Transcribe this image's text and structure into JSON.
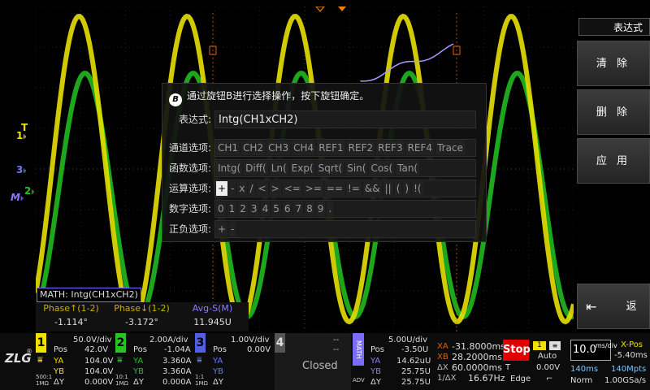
{
  "menu": {
    "title": "表达式",
    "buttons": [
      "清 除",
      "删 除",
      "应 用"
    ],
    "back": "返 回"
  },
  "channels_left": [
    {
      "label": "T",
      "color": "#f0e000"
    },
    {
      "label": "1",
      "color": "#f0e000"
    },
    {
      "label": "3",
      "color": "#6b78ff"
    },
    {
      "label": "M",
      "color": "#8a7cff"
    },
    {
      "label": "2",
      "color": "#24c424"
    }
  ],
  "dialog": {
    "hint": "通过旋钮B进行选择操作，按下旋钮确定。",
    "hint_icon": "B",
    "expr_label": "表达式:",
    "expr_value": "Intg(CH1xCH2)",
    "rows": [
      {
        "label": "通道选项:",
        "opts": [
          "CH1",
          "CH2",
          "CH3",
          "CH4",
          "REF1",
          "REF2",
          "REF3",
          "REF4",
          "Trace"
        ],
        "sel": -1
      },
      {
        "label": "函数选项:",
        "opts": [
          "Intg(",
          "Diff(",
          "Ln(",
          "Exp(",
          "Sqrt(",
          "Sin(",
          "Cos(",
          "Tan("
        ],
        "sel": -1
      },
      {
        "label": "运算选项:",
        "opts": [
          "+",
          "-",
          "x",
          "/",
          "<",
          ">",
          "<=",
          ">=",
          "==",
          "!=",
          "&&",
          "||",
          "(",
          ")",
          "!("
        ],
        "sel": 0
      },
      {
        "label": "数字选项:",
        "opts": [
          "0",
          "1",
          "2",
          "3",
          "4",
          "5",
          "6",
          "7",
          "8",
          "9",
          "."
        ],
        "sel": -1
      },
      {
        "label": "正负选项:",
        "opts": [
          "+",
          "-"
        ],
        "sel": -1
      }
    ]
  },
  "math_label": "MATH: Intg(CH1xCH2)",
  "measurements": [
    {
      "name": "Phase↑(1-2)",
      "value": "-1.114°"
    },
    {
      "name": "Phase↓(1-2)",
      "value": "-3.172°"
    },
    {
      "name": "Avg-S(M)",
      "value": "11.945U"
    }
  ],
  "ch1": {
    "num": "1",
    "div": "50.0V/div",
    "pos_label": "Pos",
    "pos": "42.0V",
    "ya": "104.0V",
    "yb": "104.0V",
    "dy": "0.000V",
    "coup": "500:1",
    "imp": "1MΩ"
  },
  "ch2": {
    "num": "2",
    "div": "2.00A/div",
    "pos_label": "Pos",
    "pos": "-1.04A",
    "ya": "3.360A",
    "yb": "3.360A",
    "dy": "0.000A",
    "coup": "10:1",
    "imp": "1MΩ"
  },
  "ch3": {
    "num": "3",
    "div": "1.00V/div",
    "pos_label": "Pos",
    "pos": "0.00V",
    "coup": "1:1",
    "imp": "1MΩ"
  },
  "ch4": {
    "num": "4",
    "div": "--",
    "pos": "--",
    "status": "Closed"
  },
  "math": {
    "num": "MATH",
    "div": "5.00U/div",
    "pos_label": "Pos",
    "pos": "-3.50U",
    "ya": "14.62uU",
    "yb": "25.75U",
    "dy": "25.75U",
    "mode": "ADV"
  },
  "cursors": {
    "xa": "-31.8000ms",
    "xb": "28.2000ms",
    "dx": "60.0000ms",
    "inv_dx": "16.67Hz"
  },
  "trigger": {
    "state": "Stop",
    "source": "1",
    "mode": "Auto",
    "type": "T",
    "level": "0.00V",
    "edge": "Edge"
  },
  "timebase": {
    "value": "10.0",
    "unit": "ms/div",
    "xpos_label": "X-Pos",
    "xpos": "-5.40ms",
    "length": "140ms",
    "mem": "140Mpts",
    "acq": "Norm",
    "rate": "1.00GSa/s"
  },
  "logo": "ZLG"
}
